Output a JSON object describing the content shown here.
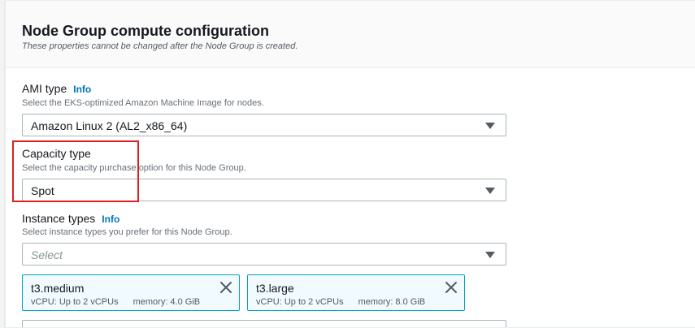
{
  "header": {
    "title": "Node Group compute configuration",
    "subtitle": "These properties cannot be changed after the Node Group is created."
  },
  "ami": {
    "label": "AMI type",
    "info": "Info",
    "description": "Select the EKS-optimized Amazon Machine Image for nodes.",
    "value": "Amazon Linux 2 (AL2_x86_64)"
  },
  "capacity": {
    "label": "Capacity type",
    "description": "Select the capacity purchase option for this Node Group.",
    "value": "Spot"
  },
  "instance": {
    "label": "Instance types",
    "info": "Info",
    "description": "Select instance types you prefer for this Node Group.",
    "placeholder": "Select",
    "tokens": [
      {
        "name": "t3.medium",
        "vcpu": "vCPU: Up to 2 vCPUs",
        "memory": "memory: 4.0 GiB"
      },
      {
        "name": "t3.large",
        "vcpu": "vCPU: Up to 2 vCPUs",
        "memory": "memory: 8.0 GiB"
      }
    ]
  },
  "colors": {
    "link": "#0073bb",
    "highlight": "#e02020",
    "token_border": "#00a1c9",
    "token_bg": "#f1faff"
  },
  "icons": {
    "dropdown": "caret-down-icon",
    "remove": "close-icon"
  }
}
